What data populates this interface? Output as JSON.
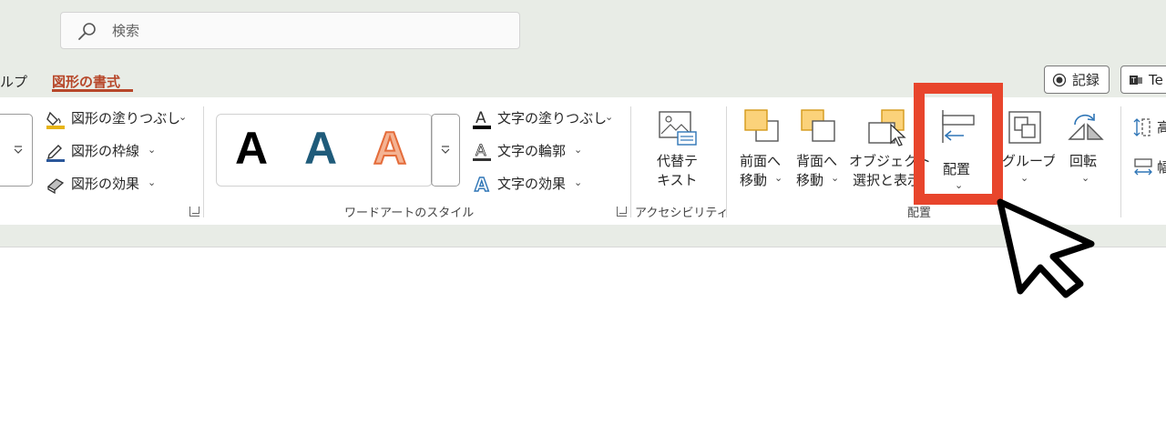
{
  "search": {
    "placeholder": "検索"
  },
  "tabs": {
    "group_partial": "ルプ",
    "shape_format": "図形の書式"
  },
  "header": {
    "record": "記録",
    "teams_partial": "Te"
  },
  "shape_styles": {
    "fill": "図形の塗りつぶし",
    "outline": "図形の枠線",
    "effects": "図形の効果"
  },
  "wordart": {
    "group_label": "ワードアートのスタイル",
    "text_fill": "文字の塗りつぶし",
    "text_outline": "文字の輪郭",
    "text_effects": "文字の効果",
    "sample": "A"
  },
  "accessibility": {
    "group_label": "アクセシビリティ",
    "alt_text_line1": "代替テ",
    "alt_text_line2": "キスト"
  },
  "arrange": {
    "group_label": "配置",
    "bring_forward_line1": "前面へ",
    "bring_forward_line2": "移動",
    "send_backward_line1": "背面へ",
    "send_backward_line2": "移動",
    "selection_pane_line1": "オブジェクト",
    "selection_pane_line2": "選択と表示",
    "align": "配置",
    "group": "グループ化",
    "rotate": "回転"
  },
  "size": {
    "height_partial": "高",
    "width_partial": "幅"
  },
  "colors": {
    "accent": "#b7472a",
    "highlight": "#e8452c",
    "chrome": "#e8ece6"
  }
}
